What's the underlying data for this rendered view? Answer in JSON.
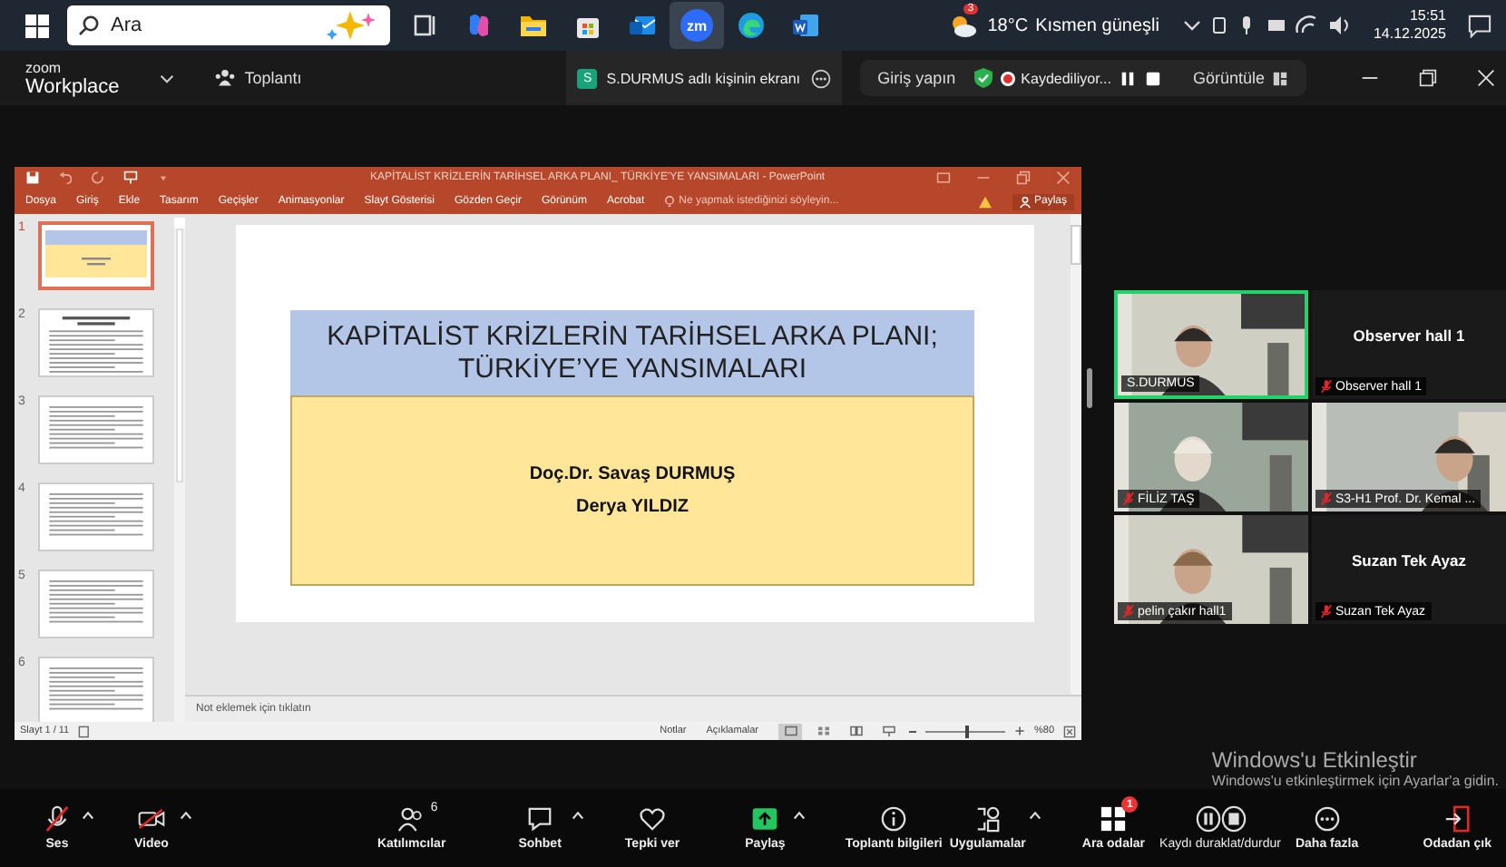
{
  "taskbar": {
    "search": {
      "placeholder": "Ara"
    },
    "apps": [
      {
        "kind": "taskview",
        "selected": false
      },
      {
        "kind": "copilot",
        "selected": false
      },
      {
        "kind": "folder",
        "selected": false
      },
      {
        "kind": "store",
        "selected": false
      },
      {
        "kind": "mail",
        "selected": false
      },
      {
        "kind": "zoom",
        "label": "zm",
        "selected": true
      },
      {
        "kind": "edge",
        "selected": false
      },
      {
        "kind": "word",
        "selected": false
      }
    ],
    "weather": {
      "badge": "3",
      "temperature": "18°C",
      "condition": "Kısmen güneşli"
    },
    "clock": {
      "time": "15:51",
      "date": "14.12.2025"
    }
  },
  "zoom_bar": {
    "brand_top": "zoom",
    "brand": "Workplace",
    "menu": "Toplantı",
    "tab": {
      "badge": "S",
      "label": "S.DURMUS adlı kişinin ekranı"
    },
    "sign_in": "Giriş yapın",
    "recording": "Kaydediliyor...",
    "view": "Görüntüle"
  },
  "powerpoint": {
    "title": "KAPİTALİST KRİZLERİN TARİHSEL ARKA PLANI_ TÜRKİYE'YE YANSIMALARI - PowerPoint",
    "tabs": [
      "Dosya",
      "Giriş",
      "Ekle",
      "Tasarım",
      "Geçişler",
      "Animasyonlar",
      "Slayt Gösterisi",
      "Gözden Geçir",
      "Görünüm",
      "Acrobat"
    ],
    "tell_me": "Ne yapmak istediğinizi söyleyin...",
    "share": "Paylaş",
    "thumbnails": [
      {
        "number": "1",
        "kind": "title",
        "selected": true
      },
      {
        "number": "2",
        "kind": "heading",
        "selected": false
      },
      {
        "number": "3",
        "kind": "text",
        "selected": false
      },
      {
        "number": "4",
        "kind": "text",
        "selected": false
      },
      {
        "number": "5",
        "kind": "text",
        "selected": false
      },
      {
        "number": "6",
        "kind": "text",
        "selected": false
      }
    ],
    "slide": {
      "title": "KAPİTALİST KRİZLERİN TARİHSEL ARKA PLANI;\nTÜRKİYE’YE YANSIMALARI",
      "authors": [
        "Doç.Dr. Savaş DURMUŞ",
        "Derya YILDIZ"
      ]
    },
    "notes_placeholder": "Not eklemek için tıklatın",
    "status": {
      "slide": "Slayt 1 / 11",
      "notes": "Notlar",
      "comments": "Açıklamalar",
      "views": [
        {
          "kind": "normal",
          "selected": true
        },
        {
          "kind": "sorter",
          "selected": false
        },
        {
          "kind": "reading",
          "selected": false
        },
        {
          "kind": "show",
          "selected": false
        }
      ],
      "zoom_slider": {
        "level": 0.5
      },
      "zoom": "%80"
    }
  },
  "participants": [
    {
      "name": "S.DURMUS",
      "video": true,
      "muted": false,
      "speaking": true
    },
    {
      "name": "Observer hall 1",
      "title": "Observer hall 1",
      "video": false,
      "muted": true,
      "speaking": false
    },
    {
      "name": "FİLİZ TAŞ",
      "video": true,
      "muted": true,
      "speaking": false
    },
    {
      "name": "S3-H1 Prof. Dr. Kemal ...",
      "video": true,
      "muted": true,
      "speaking": false
    },
    {
      "name": "pelin çakır hall1",
      "video": true,
      "muted": true,
      "speaking": false
    },
    {
      "name": "Suzan Tek Ayaz",
      "title": "Suzan Tek Ayaz",
      "video": false,
      "muted": true,
      "speaking": false
    }
  ],
  "activation": {
    "title": "Windows'u Etkinleştir",
    "text": "Windows'u etkinleştirmek için Ayarlar'a gidin."
  },
  "toolbar": [
    {
      "kind": "audio",
      "label": "Ses",
      "off": true,
      "caret": true
    },
    {
      "kind": "video",
      "label": "Video",
      "off": true,
      "caret": true
    },
    {
      "kind": "participants",
      "label": "Katılımcılar",
      "count": "6",
      "caret": false
    },
    {
      "kind": "chat",
      "label": "Sohbet",
      "caret": true
    },
    {
      "kind": "react",
      "label": "Tepki ver",
      "caret": false
    },
    {
      "kind": "share",
      "label": "Paylaş",
      "caret": true
    },
    {
      "kind": "info",
      "label": "Toplantı bilgileri",
      "caret": false
    },
    {
      "kind": "apps",
      "label": "Uygulamalar",
      "caret": true
    },
    {
      "kind": "rooms",
      "label": "Ara odalar",
      "badge": "1",
      "caret": false
    },
    {
      "kind": "record",
      "label": "Kaydı duraklat/durdur",
      "caret": false
    },
    {
      "kind": "more",
      "label": "Daha fazla",
      "caret": false
    },
    {
      "kind": "leave",
      "label": "Odadan çık",
      "caret": false
    }
  ]
}
